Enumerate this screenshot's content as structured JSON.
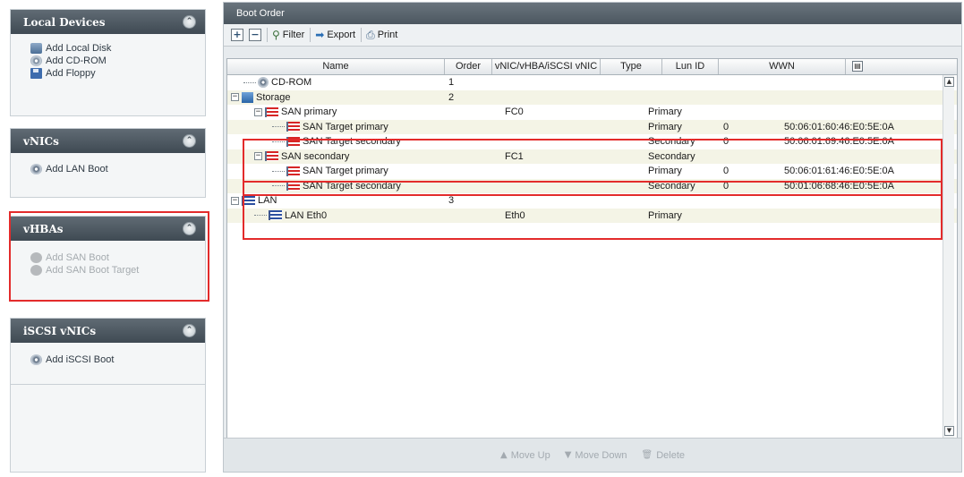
{
  "left_panels": {
    "local_devices": {
      "title": "Local Devices",
      "actions": [
        "Add Local Disk",
        "Add CD-ROM",
        "Add Floppy"
      ]
    },
    "vnics": {
      "title": "vNICs",
      "actions": [
        "Add LAN Boot"
      ]
    },
    "vhbas": {
      "title": "vHBAs",
      "actions": [
        "Add SAN Boot",
        "Add SAN Boot Target"
      ]
    },
    "iscsi_vnics": {
      "title": "iSCSI vNICs",
      "actions": [
        "Add iSCSI Boot"
      ]
    },
    "collapse_glyph": "⌃"
  },
  "main": {
    "title": "Boot Order",
    "toolbar": {
      "expand": "+",
      "collapse": "−",
      "filter": "Filter",
      "export": "Export",
      "print": "Print"
    },
    "columns": [
      "Name",
      "Order",
      "vNIC/vHBA/iSCSI vNIC",
      "Type",
      "Lun ID",
      "WWN"
    ],
    "rows": [
      {
        "name": "CD-ROM",
        "order": "1",
        "vnic": "",
        "type": "",
        "lun": "",
        "wwn": ""
      },
      {
        "name": "Storage",
        "order": "2",
        "vnic": "",
        "type": "",
        "lun": "",
        "wwn": ""
      },
      {
        "name": "SAN primary",
        "order": "",
        "vnic": "FC0",
        "type": "Primary",
        "lun": "",
        "wwn": ""
      },
      {
        "name": "SAN Target primary",
        "order": "",
        "vnic": "",
        "type": "Primary",
        "lun": "0",
        "wwn": "50:06:01:60:46:E0:5E:0A"
      },
      {
        "name": "SAN Target secondary",
        "order": "",
        "vnic": "",
        "type": "Secondary",
        "lun": "0",
        "wwn": "50:06:01:69:46:E0:5E:0A"
      },
      {
        "name": "SAN secondary",
        "order": "",
        "vnic": "FC1",
        "type": "Secondary",
        "lun": "",
        "wwn": ""
      },
      {
        "name": "SAN Target primary",
        "order": "",
        "vnic": "",
        "type": "Primary",
        "lun": "0",
        "wwn": "50:06:01:61:46:E0:5E:0A"
      },
      {
        "name": "SAN Target secondary",
        "order": "",
        "vnic": "",
        "type": "Secondary",
        "lun": "0",
        "wwn": "50:01:06:68:46:E0:5E:0A"
      },
      {
        "name": "LAN",
        "order": "3",
        "vnic": "",
        "type": "",
        "lun": "",
        "wwn": ""
      },
      {
        "name": "LAN Eth0",
        "order": "",
        "vnic": "Eth0",
        "type": "Primary",
        "lun": "",
        "wwn": ""
      }
    ],
    "footer": {
      "move_up": "Move Up",
      "move_down": "Move Down",
      "delete": "Delete"
    }
  },
  "colors": {
    "highlight": "#e32b2b",
    "header_dark": "#4c5760",
    "row_shade": "#f4f4e6"
  }
}
